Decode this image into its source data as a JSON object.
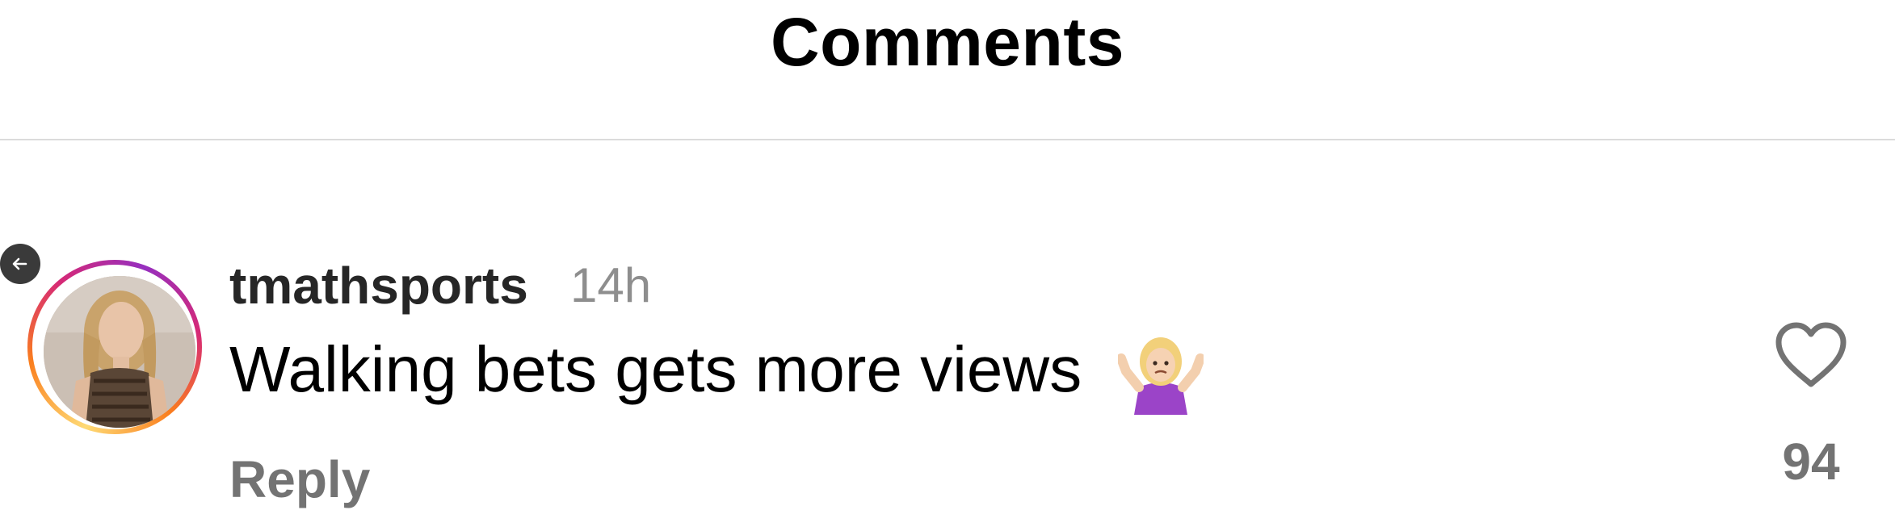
{
  "header": {
    "title": "Comments"
  },
  "comment": {
    "username": "tmathsports",
    "timestamp": "14h",
    "text": "Walking bets gets more views",
    "emoji": "person-shrugging-emoji",
    "reply_label": "Reply",
    "like_count": "94",
    "avatar_ring_colors": [
      "#feda75",
      "#fa7e1e",
      "#d62976",
      "#962fbf"
    ]
  },
  "icons": {
    "back": "arrow-left-icon",
    "like": "heart-outline-icon"
  }
}
